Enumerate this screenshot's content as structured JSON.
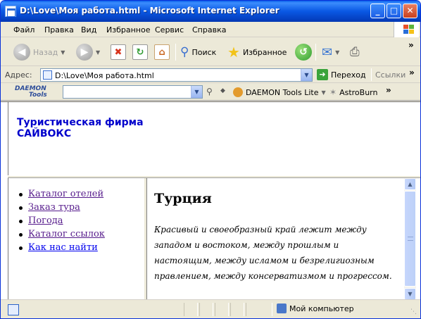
{
  "window": {
    "title": "D:\\Love\\Моя работа.html - Microsoft Internet Explorer",
    "controls": {
      "minimize": "_",
      "maximize": "□",
      "close": "✕"
    }
  },
  "menubar": {
    "items": [
      "Файл",
      "Правка",
      "Вид",
      "Избранное",
      "Сервис",
      "Справка"
    ]
  },
  "toolbar": {
    "back_label": "Назад",
    "search_label": "Поиск",
    "favorites_label": "Избранное",
    "more": "»"
  },
  "addressbar": {
    "label": "Адрес:",
    "url": "D:\\Love\\Моя работа.html",
    "go_label": "Переход",
    "links_label": "Ссылки",
    "more": "»"
  },
  "daemonbar": {
    "logo_line1": "DAEMON",
    "logo_line2": "Tools",
    "search_value": "",
    "daemon_lite_label": "DAEMON Tools Lite",
    "astroburn_label": "AstroBurn",
    "more": "»"
  },
  "page": {
    "brand": "Туристическая фирма САЙВОКС",
    "nav": [
      {
        "label": "Каталог отелей",
        "visited": true
      },
      {
        "label": "Заказ тура",
        "visited": true
      },
      {
        "label": "Погода",
        "visited": true
      },
      {
        "label": "Каталог ссылок",
        "visited": true
      },
      {
        "label": "Как нас найти",
        "visited": false
      }
    ],
    "article_title": "Турция",
    "article_body": "Красивый и своеобразный край лежит между западом и востоком, между прошлым и настоящим, между исламом и безрелигиозным правлением, между консерватизмом и прогрессом."
  },
  "statusbar": {
    "zone_label": "Мой компьютер"
  }
}
